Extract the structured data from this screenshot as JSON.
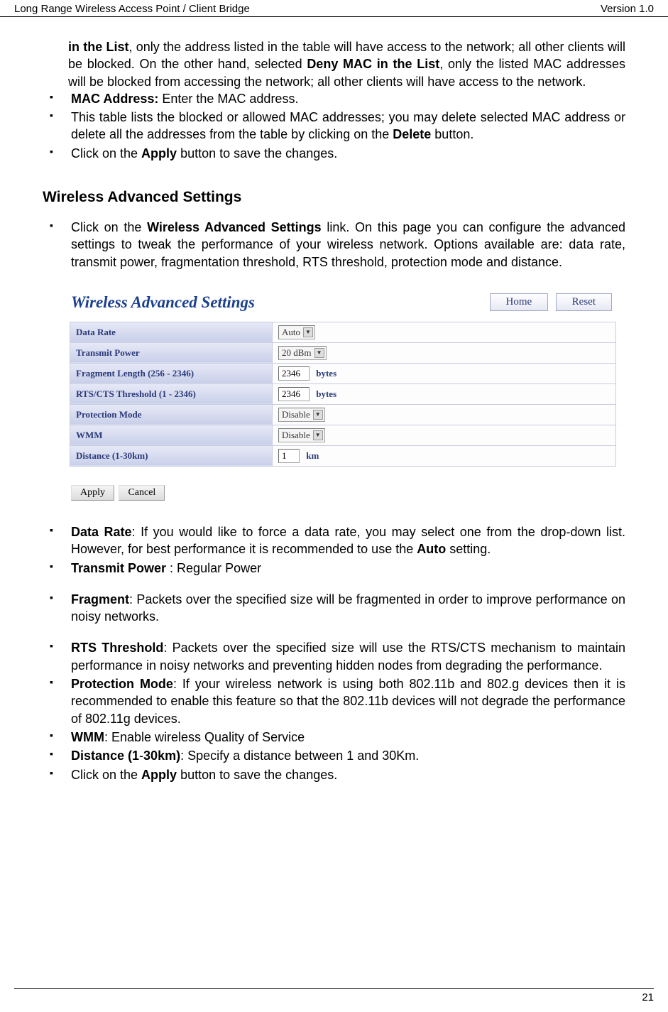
{
  "header": {
    "left": "Long Range Wireless Access Point / Client Bridge",
    "right": "Version 1.0"
  },
  "intro": {
    "lead": "in the List",
    "cont1": ", only the address listed in the table will have access to the network; all other clients will be blocked. On the other hand, selected ",
    "deny": "Deny MAC in the List",
    "cont2": ", only the listed MAC addresses will be blocked from accessing the network; all other clients will have access to the network."
  },
  "bullets_top": {
    "b1a": "MAC Address:",
    "b1b": " Enter the MAC address.",
    "b2a": "This table lists the blocked or allowed MAC addresses; you may delete selected MAC address or delete all the addresses from the table by clicking on the ",
    "b2b": "Delete",
    "b2c": " button.",
    "b3a": "Click on the ",
    "b3b": "Apply",
    "b3c": " button to save the changes."
  },
  "heading": "Wireless Advanced Settings",
  "bullets_mid": {
    "b1a": "Click on the ",
    "b1b": "Wireless Advanced Settings",
    "b1c": " link. On this page you can configure the advanced settings to tweak the performance of your wireless network. Options available are: data rate, transmit power, fragmentation threshold, RTS threshold, protection mode and distance."
  },
  "screenshot": {
    "title": "Wireless Advanced Settings",
    "home": "Home",
    "reset": "Reset",
    "rows": {
      "r1": {
        "label": "Data Rate",
        "value": "Auto"
      },
      "r2": {
        "label": "Transmit Power",
        "value": "20 dBm"
      },
      "r3": {
        "label": "Fragment Length (256 - 2346)",
        "value": "2346",
        "unit": "bytes"
      },
      "r4": {
        "label": "RTS/CTS Threshold (1 - 2346)",
        "value": "2346",
        "unit": "bytes"
      },
      "r5": {
        "label": "Protection Mode",
        "value": "Disable"
      },
      "r6": {
        "label": "WMM",
        "value": "Disable"
      },
      "r7": {
        "label": "Distance (1-30km)",
        "value": "1",
        "unit": "km"
      }
    },
    "apply": "Apply",
    "cancel": "Cancel"
  },
  "bullets_bottom": {
    "b1a": "Data Rate",
    "b1b": ": If you would like to force a data rate, you may select one from the drop-down list. However, for best performance it is recommended to use the ",
    "b1c": "Auto",
    "b1d": " setting.",
    "b2a": "Transmit Power",
    "b2b": " : Regular Power",
    "b3a": "Fragment",
    "b3b": ": Packets over the specified size will be fragmented in order to improve performance on noisy networks.",
    "b4a": "RTS Threshold",
    "b4b": ": Packets over the specified size will use the RTS/CTS mechanism to maintain performance in noisy networks and preventing hidden nodes from degrading the performance.",
    "b5a": "Protection Mode",
    "b5b": ": If your wireless network is using both 802.11b and 802.g devices then it is recommended to enable this feature so that the 802.11b devices will not degrade the performance of 802.11g devices.",
    "b6a": "WMM",
    "b6b": ": Enable wireless Quality of Service",
    "b7a": "Distance (1",
    "b7b": "-",
    "b7c": "30km)",
    "b7d": ": Specify a distance between 1 and 30Km.",
    "b8a": "Click on the ",
    "b8b": "Apply",
    "b8c": " button to save the changes."
  },
  "page_number": "21"
}
